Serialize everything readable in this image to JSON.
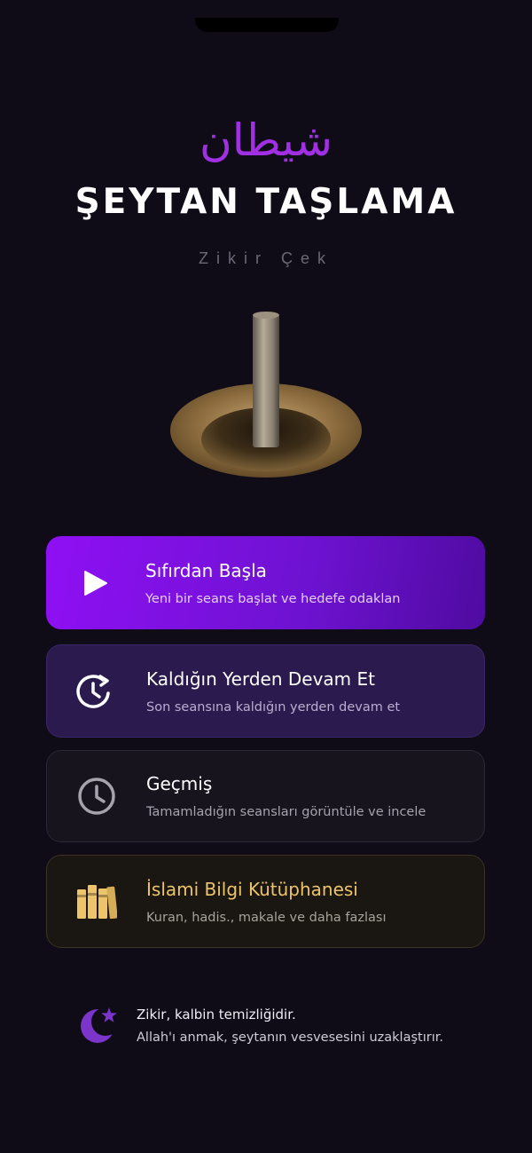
{
  "header": {
    "arabic_title": "شيطان",
    "title": "ŞEYTAN TAŞLAMA",
    "subtitle": "Zikir Çek"
  },
  "menu": {
    "start": {
      "icon": "play-icon",
      "title": "Sıfırdan Başla",
      "subtitle": "Yeni bir seans başlat ve hedefe odaklan"
    },
    "resume": {
      "icon": "clock-refresh-icon",
      "title": "Kaldığın Yerden Devam Et",
      "subtitle": "Son seansına kaldığın yerden devam et"
    },
    "history": {
      "icon": "clock-icon",
      "title": "Geçmiş",
      "subtitle": "Tamamladığın seansları görüntüle ve incele"
    },
    "library": {
      "icon": "books-icon",
      "title": "İslami Bilgi Kütüphanesi",
      "subtitle": "Kuran, hadis., makale ve daha fazlası"
    }
  },
  "footer": {
    "icon": "crescent-star-icon",
    "line1": "Zikir, kalbin temizliğidir.",
    "line2": "Allah'ı anmak, şeytanın vesvesesini uzaklaştırır."
  },
  "colors": {
    "background": "#0f0b17",
    "accent_purple": "#8f10f4",
    "arabic_purple": "#a12fe3",
    "library_gold": "#edc46a"
  }
}
